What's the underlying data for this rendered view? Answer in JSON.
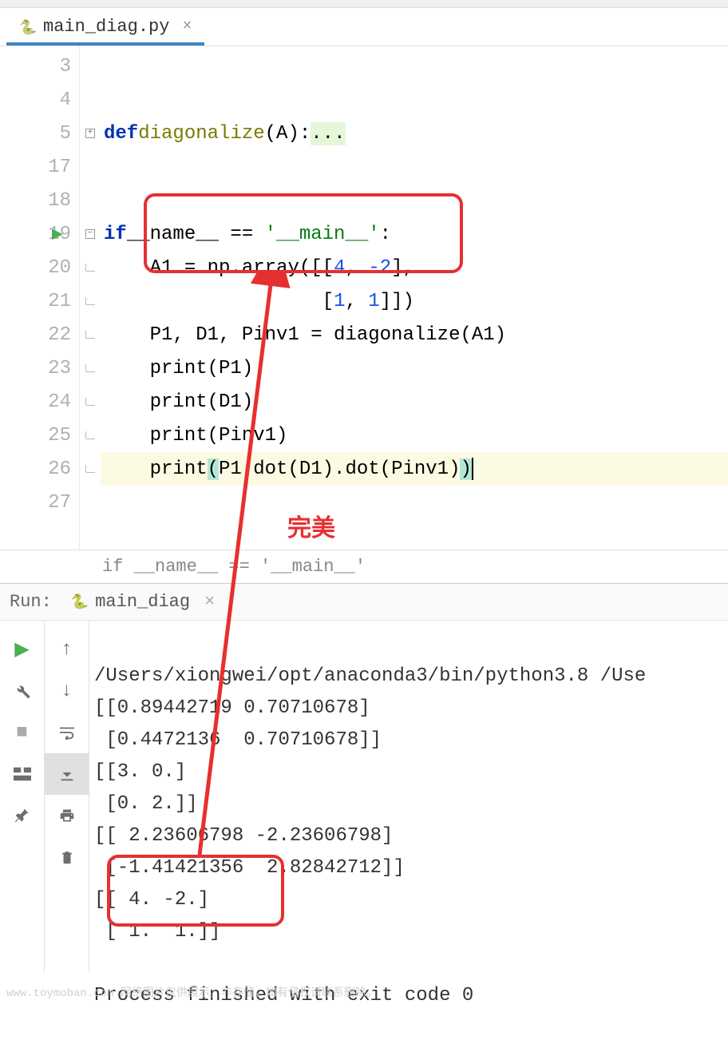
{
  "tab": {
    "filename": "main_diag.py",
    "close_glyph": "×"
  },
  "editor": {
    "lines": [
      {
        "num": "3",
        "fold": "",
        "code": ""
      },
      {
        "num": "4",
        "fold": "",
        "code": ""
      },
      {
        "num": "5",
        "fold": "plus",
        "code_def": "def",
        "code_fn": "diagonalize",
        "code_rest1": "(A)",
        "code_rest2": ":",
        "code_fold": "..."
      },
      {
        "num": "17",
        "fold": "",
        "code": ""
      },
      {
        "num": "18",
        "fold": "",
        "code": ""
      },
      {
        "num": "19",
        "fold": "minus",
        "run_marker": true,
        "kw": "if",
        "ident1": "__name__",
        "op": " == ",
        "str": "'__main__'",
        "colon": ":"
      },
      {
        "num": "20",
        "fold": "line",
        "indent": "    ",
        "lhs": "A1",
        "eq": " = ",
        "mod": "np",
        "dot": ".",
        "call": "array",
        "args1": "([[",
        "n1": "4",
        "c1": ", ",
        "n2": "-2",
        "args2": "],"
      },
      {
        "num": "21",
        "fold": "line",
        "indent": "                   ",
        "args1": "[",
        "n1": "1",
        "c1": ", ",
        "n2": "1",
        "args2": "]])"
      },
      {
        "num": "22",
        "fold": "line",
        "indent": "    ",
        "text": "P1, D1, Pinv1 = diagonalize(A1)"
      },
      {
        "num": "23",
        "fold": "line",
        "indent": "    ",
        "fn": "print",
        "args": "(P1)"
      },
      {
        "num": "24",
        "fold": "line",
        "indent": "    ",
        "fn": "print",
        "args": "(D1)"
      },
      {
        "num": "25",
        "fold": "line",
        "indent": "    ",
        "fn": "print",
        "args": "(Pinv1)"
      },
      {
        "num": "26",
        "fold": "line",
        "indent": "    ",
        "fn": "print",
        "open": "(",
        "text1": "P1.dot(D1).dot(Pinv1)",
        "close": ")",
        "hl": true
      },
      {
        "num": "27",
        "fold": "",
        "code": ""
      }
    ]
  },
  "breadcrumb": {
    "text": "if __name__ == '__main__'"
  },
  "run": {
    "label": "Run:",
    "tab_name": "main_diag",
    "tab_close": "×"
  },
  "console": {
    "path": "/Users/xiongwei/opt/anaconda3/bin/python3.8 /Use",
    "out1": "[[0.89442719 0.70710678]",
    "out2": " [0.4472136  0.70710678]]",
    "out3": "[[3. 0.]",
    "out4": " [0. 2.]]",
    "out5": "[[ 2.23606798 -2.23606798]",
    "out6": " [-1.41421356  2.82842712]]",
    "out7": "[[ 4. -2.]",
    "out8": " [ 1.  1.]]",
    "blank": "",
    "exit": "Process finished with exit code 0"
  },
  "annotation": {
    "label": "完美"
  },
  "watermark": {
    "text": "www.toymoban.com 网络图片仅供展示，非存储，如有侵权请联系删除。"
  },
  "icons": {
    "play": "▶",
    "wrench": "🔧",
    "stop": "■",
    "layout": "≡",
    "pin": "📌",
    "up": "↑",
    "down": "↓",
    "wrap": "↩",
    "scroll": "⤓",
    "print": "🖨",
    "trash": "🗑"
  }
}
